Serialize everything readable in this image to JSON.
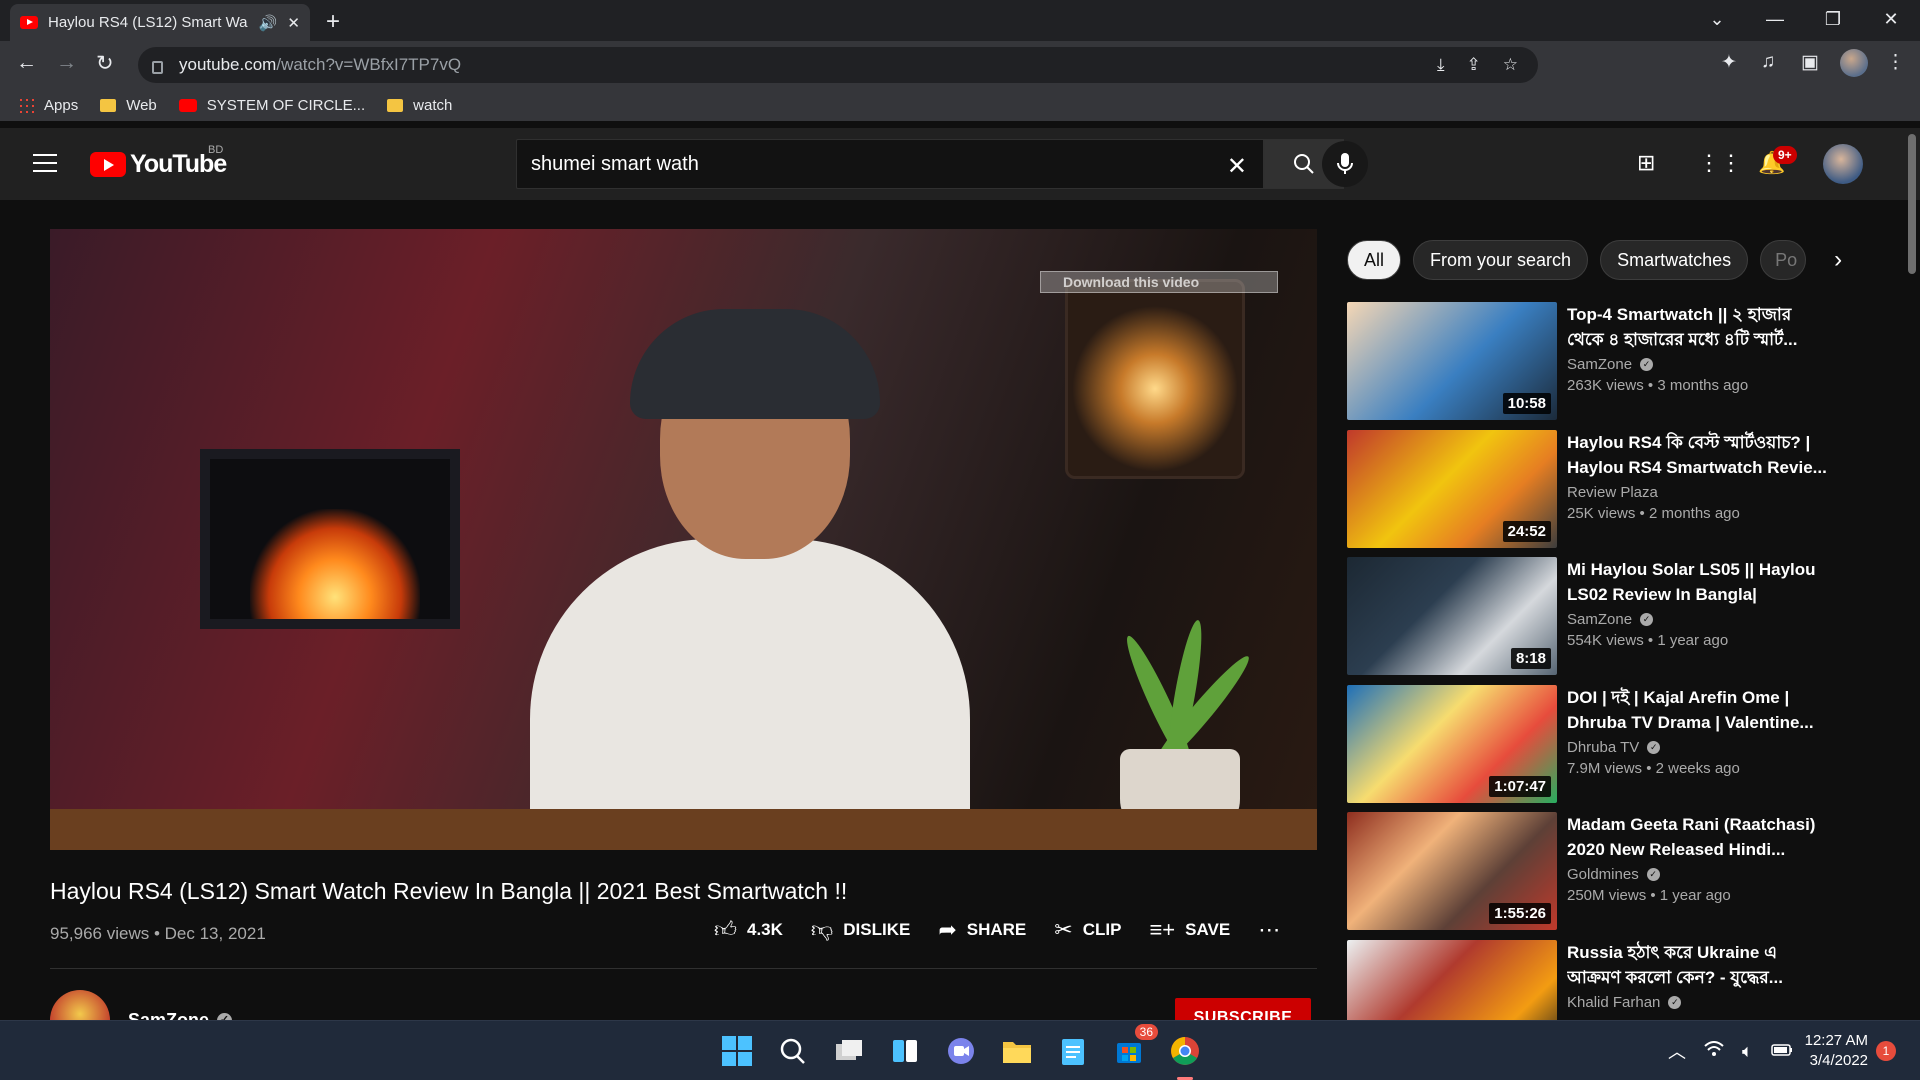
{
  "browser": {
    "tab_title": "Haylou RS4 (LS12) Smart Wa",
    "url_host": "youtube.com",
    "url_path": "/watch?v=WBfxI7TP7vQ",
    "bookmarks": [
      {
        "label": "Apps",
        "icon": "apps-grid-icon"
      },
      {
        "label": "Web",
        "icon": "folder-icon"
      },
      {
        "label": "SYSTEM OF CIRCLE...",
        "icon": "youtube-icon"
      },
      {
        "label": "watch",
        "icon": "folder-icon"
      }
    ]
  },
  "youtube": {
    "country_code": "BD",
    "search_query": "shumei smart wath",
    "notification_count": "9+",
    "video": {
      "overlay_download": "Download this video",
      "title": "Haylou RS4 (LS12) Smart Watch Review In Bangla || 2021 Best Smartwatch !!",
      "views": "95,966 views",
      "date": "Dec 13, 2021",
      "likes": "4.3K",
      "dislike_label": "DISLIKE",
      "share_label": "SHARE",
      "clip_label": "CLIP",
      "save_label": "SAVE"
    },
    "channel": {
      "name": "SamZone",
      "subscribe_label": "SUBSCRIBE"
    },
    "chips": [
      "All",
      "From your search",
      "Smartwatches",
      "Po"
    ],
    "recommendations": [
      {
        "title": "Top-4 Smartwatch || ২ হাজার থেকে ৪ হাজারের মধ্যে ৪টি স্মার্ট...",
        "channel": "SamZone",
        "views": "263K views",
        "age": "3 months ago",
        "duration": "10:58",
        "color": "#3a7fc1"
      },
      {
        "title": "Haylou RS4 কি বেস্ট স্মার্টওয়াচ? | Haylou RS4 Smartwatch Revie...",
        "channel": "Review Plaza",
        "views": "25K views",
        "age": "2 months ago",
        "duration": "24:52",
        "color": "#c0392b"
      },
      {
        "title": "Mi Haylou Solar LS05 || Haylou LS02 Review In Bangla|",
        "channel": "SamZone",
        "views": "554K views",
        "age": "1 year ago",
        "duration": "8:18",
        "color": "#2c3e50"
      },
      {
        "title": "DOI | দই | Kajal Arefin Ome | Dhruba TV Drama | Valentine...",
        "channel": "Dhruba TV",
        "views": "7.9M views",
        "age": "2 weeks ago",
        "duration": "1:07:47",
        "color": "#1e6fb8"
      },
      {
        "title": "Madam Geeta Rani (Raatchasi) 2020 New Released Hindi...",
        "channel": "Goldmines",
        "views": "250M views",
        "age": "1 year ago",
        "duration": "1:55:26",
        "color": "#8e2e1f"
      },
      {
        "title": "Russia হঠাৎ করে Ukraine এ আক্রমণ করলো কেন? - যুদ্ধের...",
        "channel": "Khalid Farhan",
        "views": "",
        "age": "",
        "duration": "",
        "color": "#b03a2e"
      }
    ]
  },
  "taskbar": {
    "teams_badge": "36",
    "time": "12:27 AM",
    "date": "3/4/2022",
    "notification_count": "1"
  }
}
